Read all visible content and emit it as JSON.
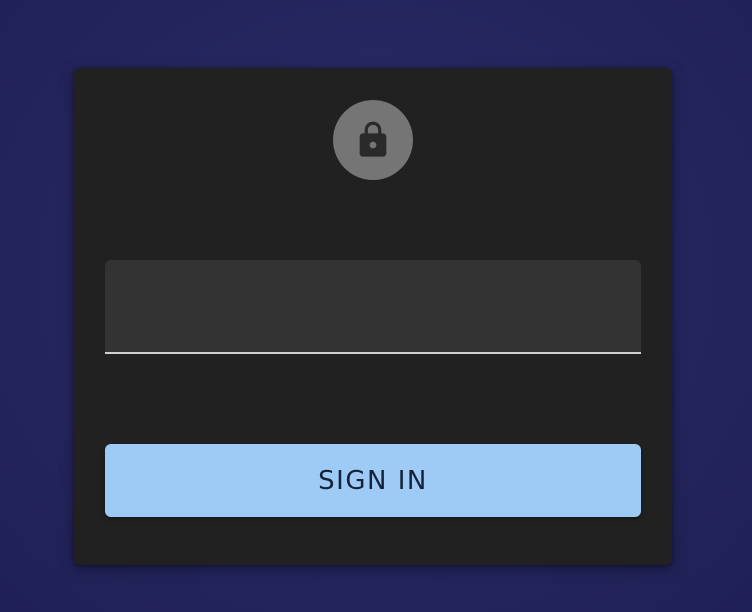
{
  "login_card": {
    "avatar_icon": "lock-icon",
    "field": {
      "value": "",
      "placeholder": ""
    },
    "sign_in_label": "SIGN IN"
  },
  "colors": {
    "background": "#262760",
    "card": "#212121",
    "avatar": "#757575",
    "field": "#333333",
    "field_underline": "#d0d0d0",
    "button": "#9ecaf6",
    "button_text": "#14233a"
  }
}
